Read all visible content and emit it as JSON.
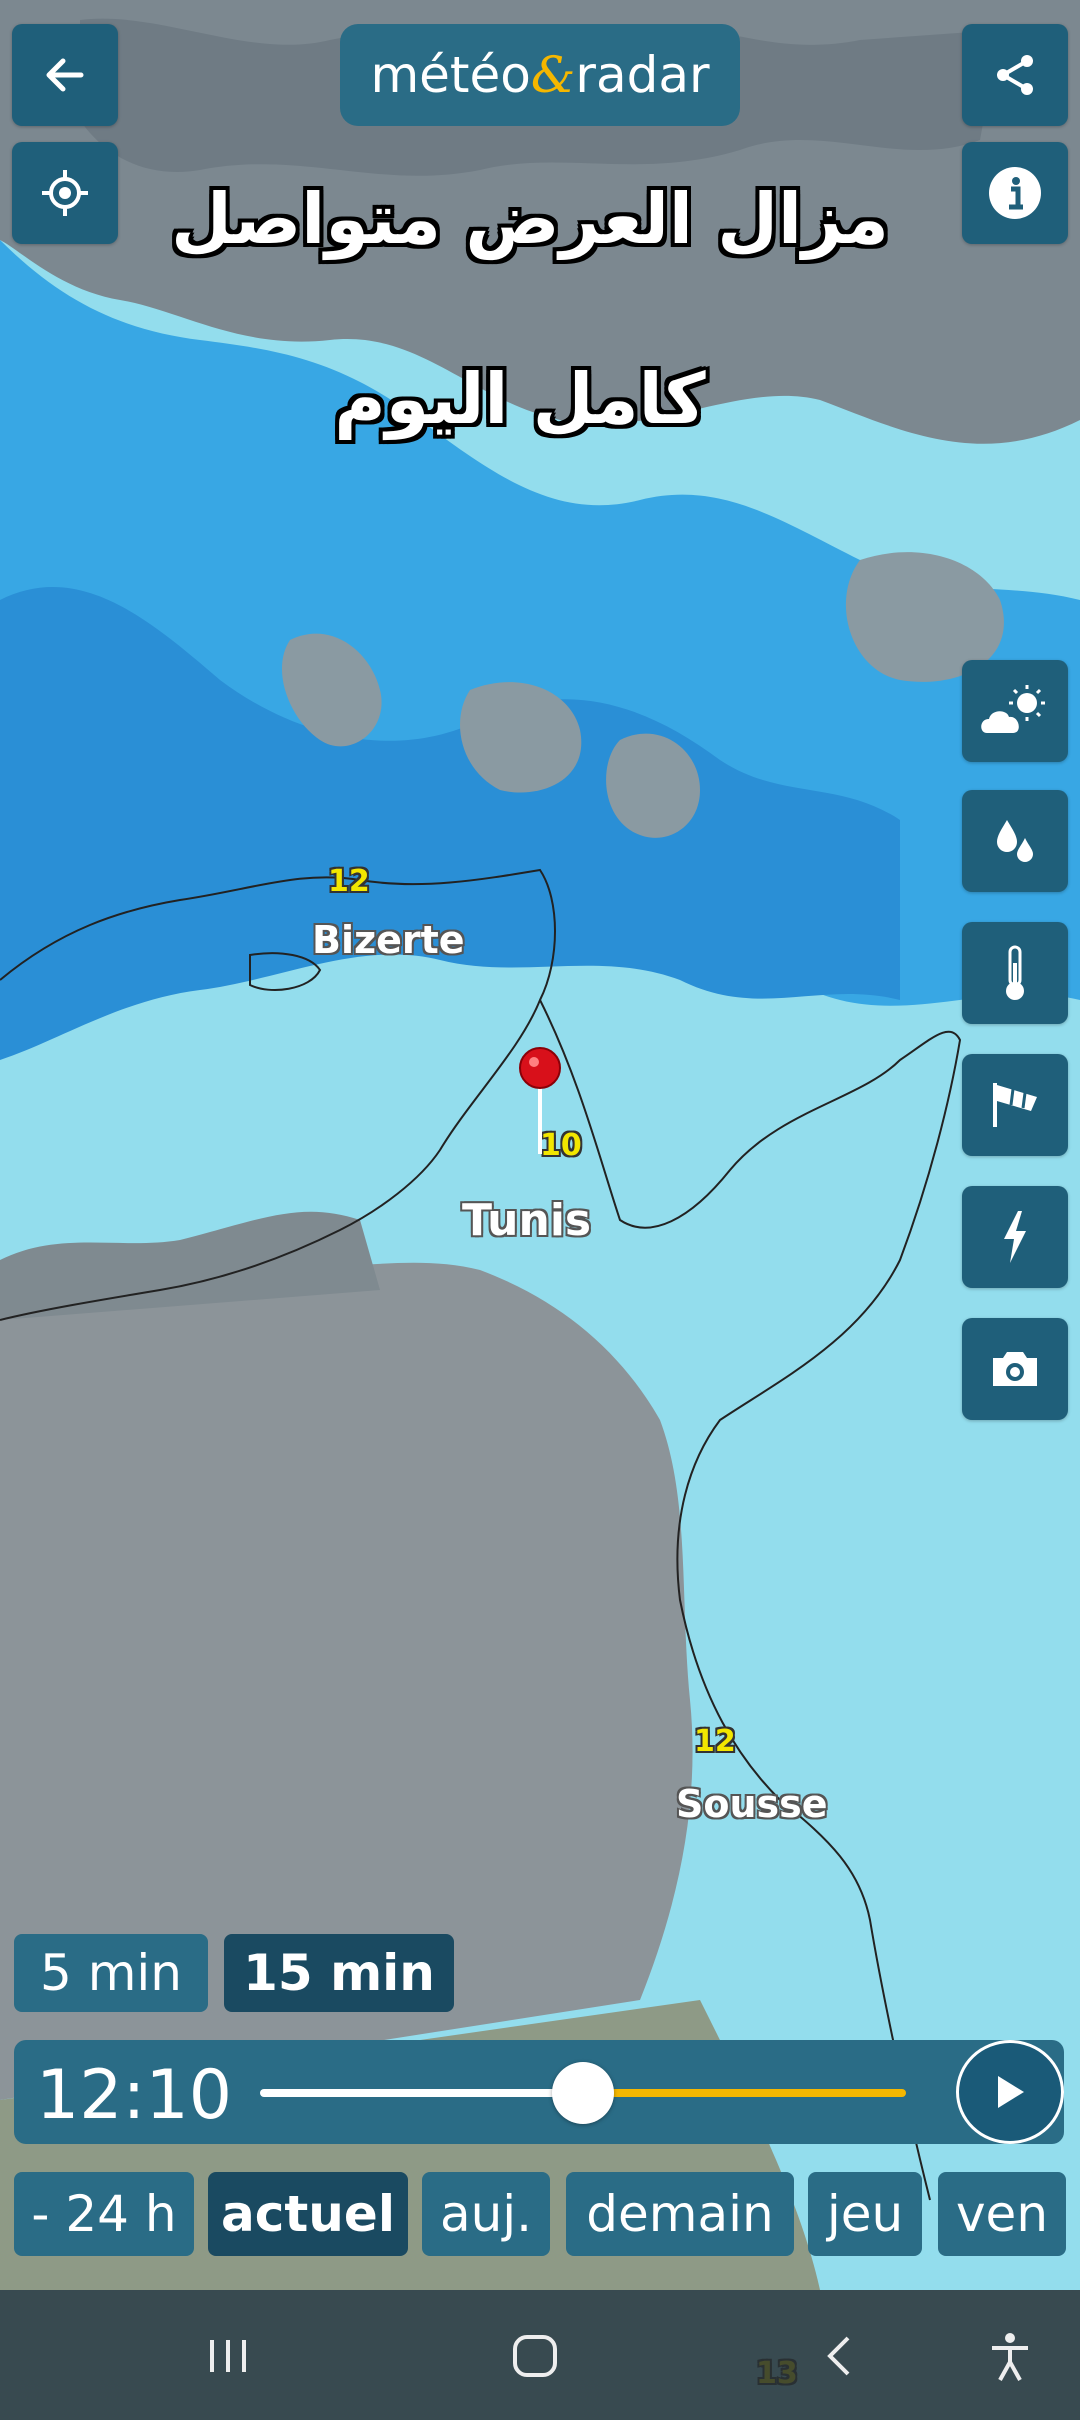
{
  "header": {
    "logo_left": "météo",
    "logo_amp": "&",
    "logo_right": "radar"
  },
  "caption": {
    "line1": "مزال العرض متواصل",
    "line2": "كامل اليوم"
  },
  "map_labels": {
    "bizerte": {
      "name": "Bizerte",
      "temp": "12"
    },
    "tunis": {
      "name": "Tunis",
      "temp": "10"
    },
    "sousse": {
      "name": "Sousse",
      "temp": "12"
    },
    "bottom_temp": "13"
  },
  "icons": {
    "back": "arrow-left-icon",
    "locate": "locate-icon",
    "share": "share-icon",
    "info": "info-icon",
    "layers": [
      "weather-icon",
      "precipitation-icon",
      "thermometer-icon",
      "wind-icon",
      "lightning-icon",
      "camera-icon"
    ]
  },
  "interval": {
    "options": [
      "5 min",
      "15 min"
    ],
    "selected": "15 min"
  },
  "timeline": {
    "time": "12:10",
    "progress": 0.5
  },
  "days": {
    "options": [
      "- 24 h",
      "actuel",
      "auj.",
      "demain",
      "jeu",
      "ven"
    ],
    "selected": "actuel"
  },
  "colors": {
    "accent": "#f5b700",
    "button": "#1f5f7a",
    "bar": "#2a6c86"
  }
}
